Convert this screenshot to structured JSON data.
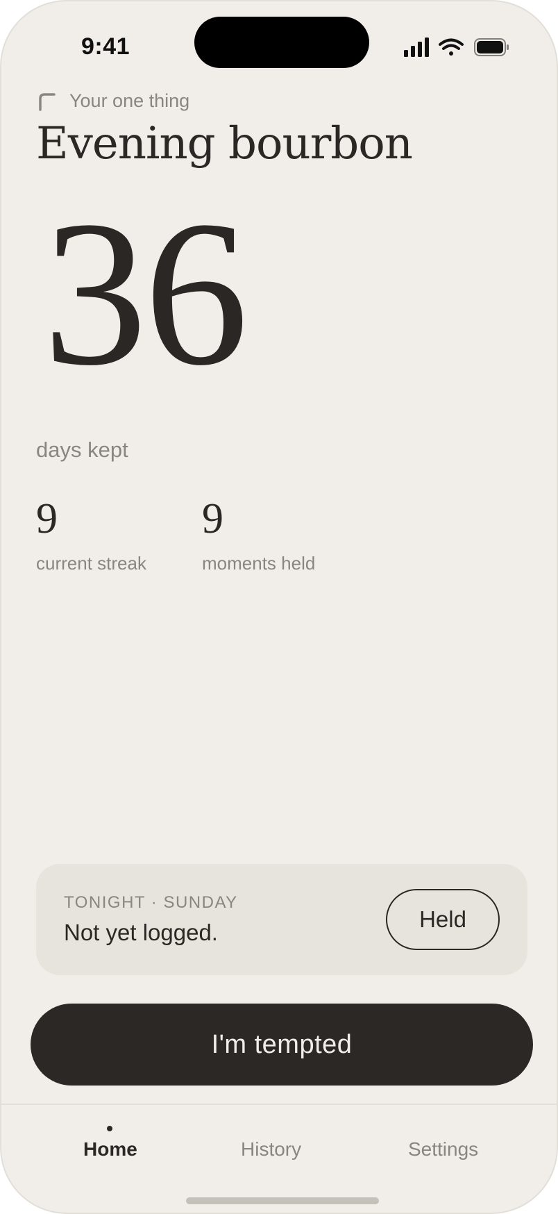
{
  "status_bar": {
    "time": "9:41",
    "icons": [
      "signal-icon",
      "wifi-icon",
      "battery-icon"
    ]
  },
  "header": {
    "eyebrow": "Your one thing",
    "title": "Evening bourbon"
  },
  "counter": {
    "value": "36",
    "label": "days kept"
  },
  "stats": [
    {
      "value": "9",
      "label": "current streak"
    },
    {
      "value": "9",
      "label": "moments held"
    }
  ],
  "tonight_card": {
    "eyebrow": "TONIGHT · SUNDAY",
    "status": "Not yet logged.",
    "button_label": "Held"
  },
  "primary_action": {
    "label": "I'm tempted"
  },
  "tab_bar": {
    "active": "Home",
    "tabs": [
      {
        "label": "Home"
      },
      {
        "label": "History"
      },
      {
        "label": "Settings"
      }
    ]
  },
  "colors": {
    "background": "#f1eee9",
    "ink": "#2b2724",
    "muted": "#8a8580",
    "card": "#e7e3dd",
    "button_dark": "#2c2825"
  }
}
